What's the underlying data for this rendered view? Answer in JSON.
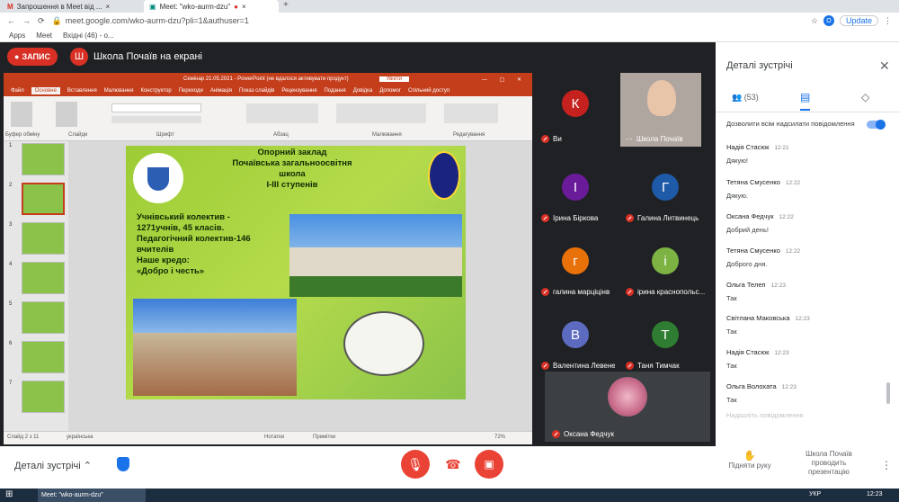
{
  "browser": {
    "tabs": [
      {
        "label": "Запрошення в Meet від ..."
      },
      {
        "label": "Meet: \"wko-aurm-dzu\""
      }
    ],
    "url": "meet.google.com/wko-aurm-dzu?pli=1&authuser=1",
    "bookmarks": [
      "Apps",
      "Meet",
      "Вхідні (46) - o..."
    ],
    "update_label": "Update",
    "profile_initial": "O"
  },
  "meet": {
    "record_label": "ЗАПИС",
    "presenter_initial": "Ш",
    "presenter_text": "Школа Почаїв на екрані",
    "tiles": [
      {
        "initial": "К",
        "name": "Ви",
        "color": "#c5221f"
      },
      {
        "initial": "",
        "name": "Школа Почаїв",
        "color": "#a0a0a0"
      },
      {
        "initial": "І",
        "name": "Ірина Біркова",
        "color": "#6a1b9a"
      },
      {
        "initial": "Г",
        "name": "Галина Литвинець",
        "color": "#1e5aa8"
      },
      {
        "initial": "г",
        "name": "галина марціцінв",
        "color": "#e8710a"
      },
      {
        "initial": "і",
        "name": "ірина краснопольс...",
        "color": "#7cb342"
      },
      {
        "initial": "В",
        "name": "Валентина Левене...",
        "color": "#5c6bc0"
      },
      {
        "initial": "Т",
        "name": "Таня Тимчак",
        "color": "#2e7d32"
      },
      {
        "initial": "",
        "name": "Оксана Федчук",
        "color": "#d88"
      }
    ],
    "bottom": {
      "details_label": "Деталі зустрічі",
      "raise_hand": "Підняти руку",
      "presenting": "Школа Почаїв проводить презентацію"
    }
  },
  "ppt": {
    "title": "Семінар 21.05.2021 - PowerPoint (не вдалося активувати продукт)",
    "signin": "Увійти",
    "ribbon_tabs": [
      "Файл",
      "Основне",
      "Вставлення",
      "Малювання",
      "Конструктор",
      "Переходи",
      "Анімація",
      "Показ слайдів",
      "Рецензування",
      "Подання",
      "Довідка",
      "Допомог",
      "Спільний доступ"
    ],
    "groups": [
      "Буфер обміну",
      "Слайди",
      "Шрифт",
      "Абзац",
      "Малювання",
      "Редагування"
    ],
    "status_left": "Слайд 2 з 11",
    "status_lang": "українська",
    "status_notes": "Нотатки",
    "status_comments": "Примітки",
    "zoom": "72%",
    "slide_numbers": [
      "1",
      "2",
      "3",
      "4",
      "5",
      "6",
      "7"
    ],
    "slide": {
      "title_lines": [
        "Опорний заклад",
        "Почаївська загальноосвітня",
        "школа",
        "І-ІІІ ступенів"
      ],
      "body_lines": [
        "Учнівський колектив -",
        "1271учнів, 45 класів.",
        "Педагогічний колектив-146",
        "вчителів",
        "Наше кредо:",
        " «Добро і честь»"
      ]
    }
  },
  "panel": {
    "title": "Деталі зустрічі",
    "people_count": "(53)",
    "allow_label": "Дозволити всім надсилати повідомлення",
    "messages": [
      {
        "who": "Надія Стасюк",
        "time": "12:21",
        "text": "Дякую!"
      },
      {
        "who": "Тетяна Смусенко",
        "time": "12:22",
        "text": "Дякую."
      },
      {
        "who": "Оксана Федчук",
        "time": "12:22",
        "text": "Добрий день!"
      },
      {
        "who": "Тетяна Смусенко",
        "time": "12:22",
        "text": "Доброго дня."
      },
      {
        "who": "Ольга Телеп",
        "time": "12:23",
        "text": "Так"
      },
      {
        "who": "Світлана Маковська",
        "time": "12:23",
        "text": "Так"
      },
      {
        "who": "Надія Стасюк",
        "time": "12:23",
        "text": "Так"
      },
      {
        "who": "Ольга Волохата",
        "time": "12:23",
        "text": "Так"
      }
    ],
    "send_placeholder": "Надішліть повідомлення"
  },
  "taskbar": {
    "app_label": "Meet: \"wko-aurm-dzu\"",
    "lang": "УКР",
    "clock": "12:23"
  }
}
